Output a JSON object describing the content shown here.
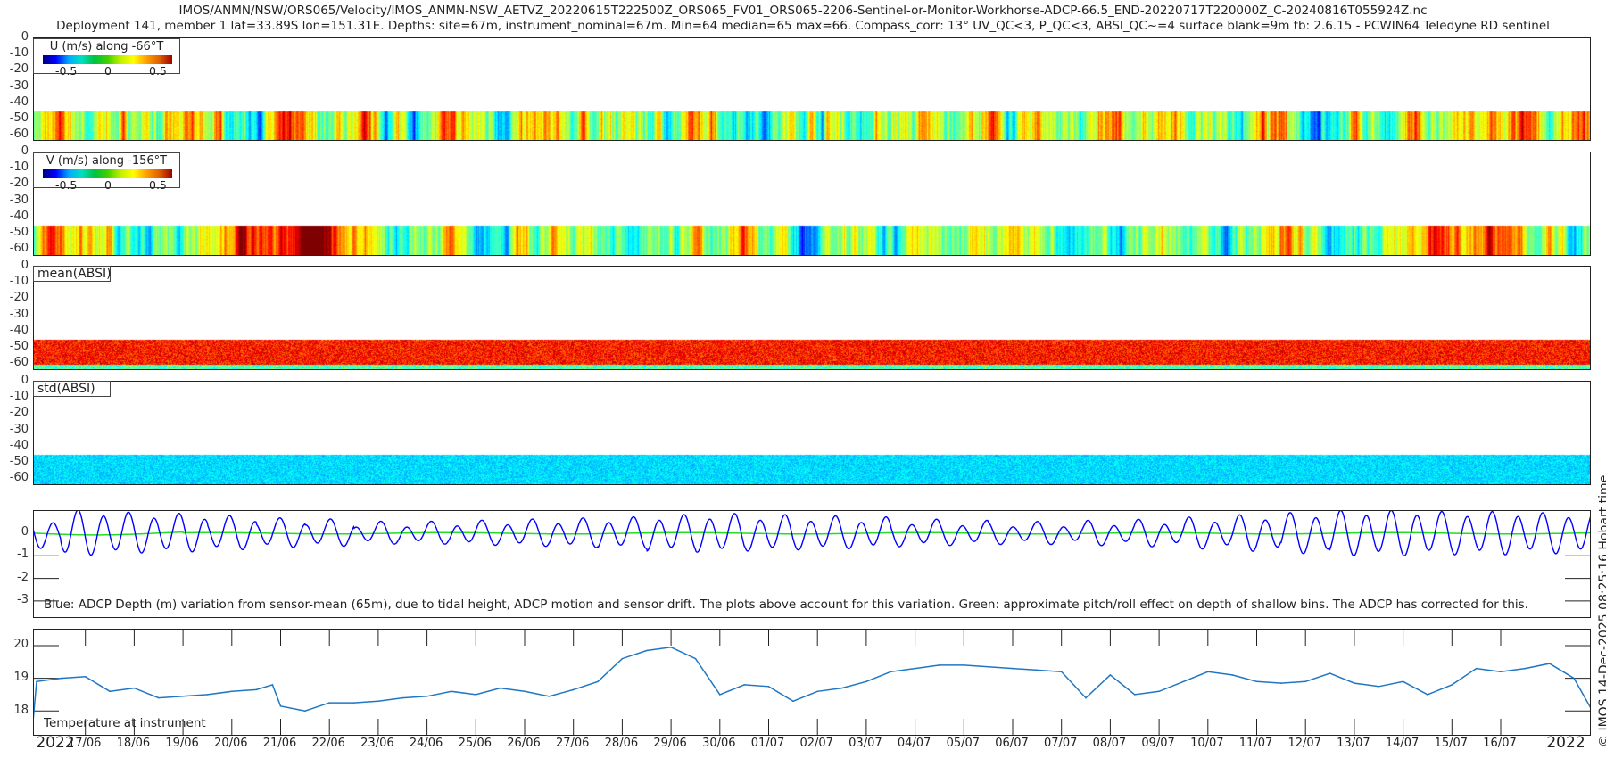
{
  "title": {
    "line1": "IMOS/ANMN/NSW/ORS065/Velocity/IMOS_ANMN-NSW_AETVZ_20220615T222500Z_ORS065_FV01_ORS065-2206-Sentinel-or-Monitor-Workhorse-ADCP-66.5_END-20220717T220000Z_C-20240816T055924Z.nc",
    "line2": "Deployment 141, member 1 lat=33.89S lon=151.31E. Depths: site=67m, instrument_nominal=67m. Min=64 median=65 max=66. Compass_corr: 13° UV_QC<3, P_QC<3, ABSI_QC~=4 surface blank=9m tb: 2.6.15 - PCWIN64 Teledyne RD sentinel"
  },
  "side_text": "© IMOS 14-Dec-2025 08:25:16 Hobart time",
  "depth_ticks": [
    "0",
    "-10",
    "-20",
    "-30",
    "-40",
    "-50",
    "-60"
  ],
  "colors": {
    "depth_line": "#0000ff",
    "pitch_roll_line": "#22dd22",
    "temperature_line": "#1f77c4",
    "surface_blank_line": "#ffffff"
  },
  "chart_data": [
    {
      "type": "heatmap",
      "name": "U",
      "label": "U (m/s) along -66°T",
      "colorbar_ticks": [
        "-0.5",
        "0",
        "0.5"
      ],
      "clim": [
        -0.75,
        0.75
      ],
      "ylim": [
        -63,
        0
      ],
      "colormap": "jet"
    },
    {
      "type": "heatmap",
      "name": "V",
      "label": "V (m/s) along -156°T",
      "colorbar_ticks": [
        "-0.5",
        "0",
        "0.5"
      ],
      "clim": [
        -0.75,
        0.75
      ],
      "ylim": [
        -63,
        0
      ],
      "colormap": "jet"
    },
    {
      "type": "heatmap",
      "name": "meanABSI",
      "label": "mean(ABSI)",
      "ylim": [
        -63,
        0
      ],
      "colormap": "jet"
    },
    {
      "type": "heatmap",
      "name": "stdABSI",
      "label": "std(ABSI)",
      "ylim": [
        -63,
        0
      ],
      "colormap": "jet"
    },
    {
      "type": "line",
      "name": "depth",
      "annotation": "Blue: ADCP Depth (m) variation from sensor-mean (65m), due to tidal height, ADCP motion and sensor drift. The plots above account for this variation. Green: approximate pitch/roll effect on depth of shallow bins. The ADCP has corrected for this.",
      "yticks": [
        "0",
        "-1",
        "-2",
        "-3"
      ],
      "ylim": [
        -1,
        3.75
      ],
      "y_reversed": true,
      "tidal_amplitude_m_by_day": [
        0.6,
        0.9,
        0.8,
        0.75,
        0.65,
        0.55,
        0.5,
        0.4,
        0.4,
        0.45,
        0.5,
        0.55,
        0.6,
        0.7,
        0.75,
        0.7,
        0.65,
        0.6,
        0.5,
        0.45,
        0.4,
        0.4,
        0.45,
        0.5,
        0.6,
        0.7,
        0.8,
        0.9,
        0.9,
        0.85,
        0.85,
        0.8,
        0.8
      ]
    },
    {
      "type": "line",
      "name": "temperature",
      "annotation": "Temperature at instrument",
      "yticks": [
        "20",
        "19",
        "18"
      ],
      "ylim": [
        17.27,
        20.49
      ],
      "x": [
        "15/06 22:25",
        "16/06 00:00",
        "16/06 12:00",
        "17/06 00:00",
        "17/06 12:00",
        "18/06 00:00",
        "18/06 12:00",
        "19/06 00:00",
        "19/06 12:00",
        "20/06 00:00",
        "20/06 12:00",
        "20/06 20:00",
        "21/06 00:00",
        "21/06 12:00",
        "22/06 00:00",
        "22/06 12:00",
        "23/06 00:00",
        "23/06 12:00",
        "24/06 00:00",
        "24/06 12:00",
        "25/06 00:00",
        "25/06 12:00",
        "26/06 00:00",
        "26/06 12:00",
        "27/06 00:00",
        "27/06 12:00",
        "28/06 00:00",
        "28/06 12:00",
        "29/06 00:00",
        "29/06 12:00",
        "30/06 00:00",
        "30/06 12:00",
        "01/07 00:00",
        "01/07 12:00",
        "02/07 00:00",
        "02/07 12:00",
        "03/07 00:00",
        "03/07 12:00",
        "04/07 00:00",
        "04/07 12:00",
        "05/07 00:00",
        "05/07 12:00",
        "06/07 00:00",
        "06/07 12:00",
        "07/07 00:00",
        "07/07 12:00",
        "08/07 00:00",
        "08/07 12:00",
        "09/07 00:00",
        "09/07 12:00",
        "10/07 00:00",
        "10/07 12:00",
        "11/07 00:00",
        "11/07 12:00",
        "12/07 00:00",
        "12/07 12:00",
        "13/07 00:00",
        "13/07 12:00",
        "14/07 00:00",
        "14/07 12:00",
        "15/07 00:00",
        "15/07 12:00",
        "16/07 00:00",
        "16/07 12:00",
        "17/07 00:00",
        "17/07 12:00",
        "17/07 22:00"
      ],
      "values": [
        17.8,
        18.9,
        19.0,
        19.05,
        18.6,
        18.7,
        18.4,
        18.45,
        18.5,
        18.6,
        18.65,
        18.8,
        18.15,
        18.0,
        18.25,
        18.25,
        18.3,
        18.4,
        18.45,
        18.6,
        18.5,
        18.7,
        18.6,
        18.45,
        18.65,
        18.9,
        19.6,
        19.85,
        19.95,
        19.6,
        18.5,
        18.8,
        18.75,
        18.3,
        18.6,
        18.7,
        18.9,
        19.2,
        19.3,
        19.4,
        19.4,
        19.35,
        19.3,
        19.25,
        19.2,
        18.4,
        19.1,
        18.5,
        18.6,
        18.9,
        19.2,
        19.1,
        18.9,
        18.85,
        18.9,
        19.15,
        18.85,
        18.75,
        18.9,
        18.5,
        18.8,
        19.3,
        19.2,
        19.3,
        19.45,
        19.0,
        17.9
      ]
    },
    {
      "type": "axis",
      "xtick_labels": [
        "17/06",
        "18/06",
        "19/06",
        "20/06",
        "21/06",
        "22/06",
        "23/06",
        "24/06",
        "25/06",
        "26/06",
        "27/06",
        "28/06",
        "29/06",
        "30/06",
        "01/07",
        "02/07",
        "03/07",
        "04/07",
        "05/07",
        "06/07",
        "07/07",
        "08/07",
        "09/07",
        "10/07",
        "11/07",
        "12/07",
        "13/07",
        "14/07",
        "15/07",
        "16/07"
      ],
      "year_left": "2022",
      "year_right": "2022"
    }
  ]
}
